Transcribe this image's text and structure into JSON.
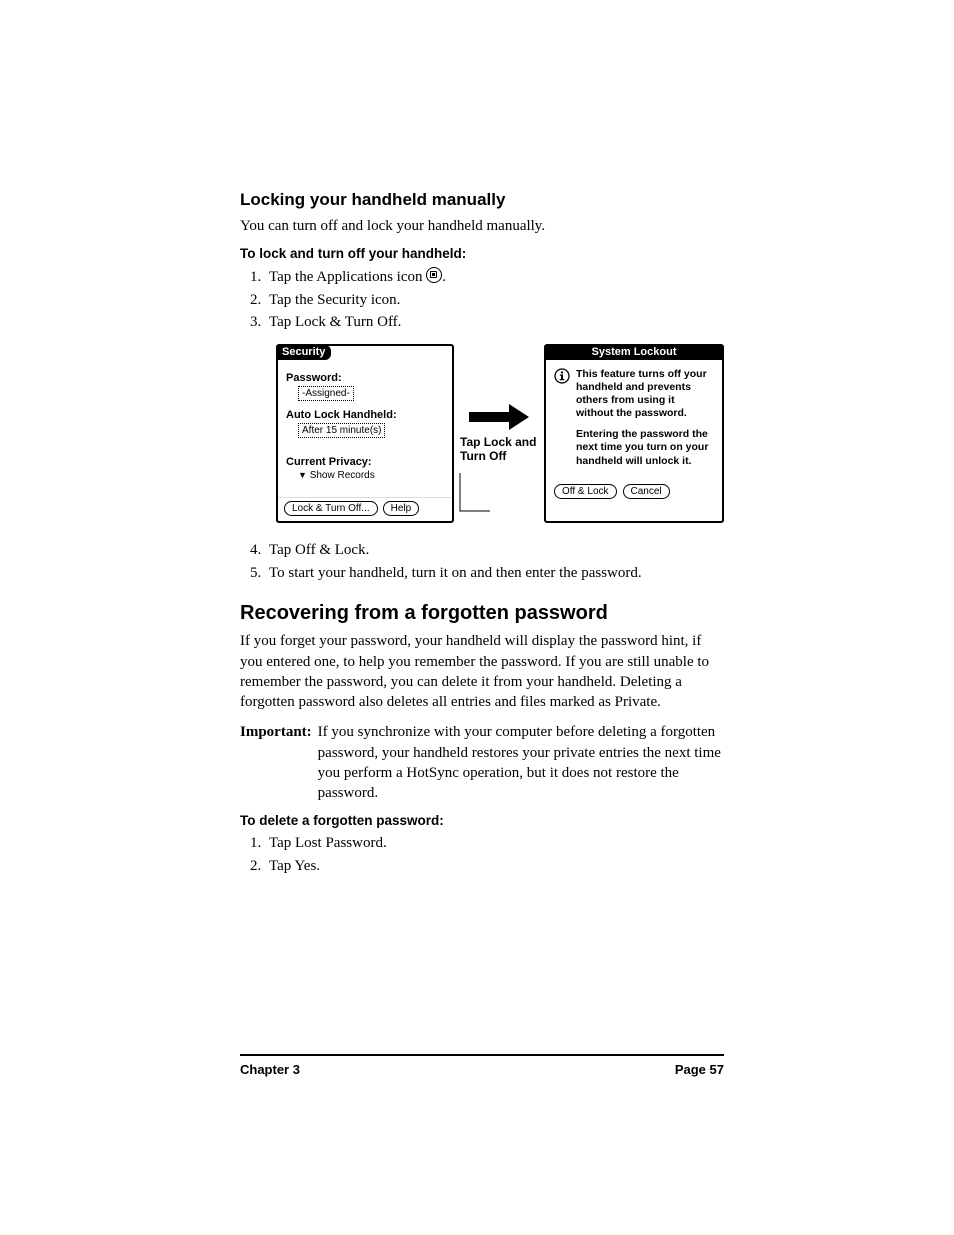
{
  "section1": {
    "heading": "Locking your handheld manually",
    "intro": "You can turn off and lock your handheld manually.",
    "proc_title": "To lock and turn off your handheld:",
    "steps_a": [
      "Tap the Applications icon",
      "Tap the Security icon.",
      "Tap Lock & Turn Off."
    ],
    "step1_suffix": ".",
    "steps_b": [
      "Tap Off & Lock.",
      "To start your handheld, turn it on and then enter the password."
    ]
  },
  "figure": {
    "security": {
      "title": "Security",
      "password_label": "Password:",
      "password_value": "-Assigned-",
      "autolock_label": "Auto Lock Handheld:",
      "autolock_value": "After 15 minute(s)",
      "privacy_label": "Current Privacy:",
      "privacy_value": "Show Records",
      "btn_lock": "Lock & Turn Off...",
      "btn_help": "Help"
    },
    "arrow_caption": "Tap Lock and Turn Off",
    "lockout": {
      "title": "System Lockout",
      "para1": "This feature turns off your handheld and prevents others from using it without the password.",
      "para2": "Entering the password the next time you turn on your handheld will unlock it.",
      "btn_off": "Off & Lock",
      "btn_cancel": "Cancel"
    }
  },
  "section2": {
    "heading": "Recovering from a forgotten password",
    "para": "If you forget your password, your handheld will display the password hint, if you entered one, to help you remember the password. If you are still unable to remember the password, you can delete it from your handheld. Deleting a forgotten password also deletes all entries and files marked as Private.",
    "important_label": "Important:",
    "important_text": "If you synchronize with your computer before deleting a forgotten password, your handheld restores your private entries the next time you perform a HotSync operation, but it does not restore the password.",
    "proc_title": "To delete a forgotten password:",
    "steps": [
      "Tap Lost Password.",
      "Tap Yes."
    ]
  },
  "footer": {
    "left": "Chapter 3",
    "right": "Page 57"
  }
}
